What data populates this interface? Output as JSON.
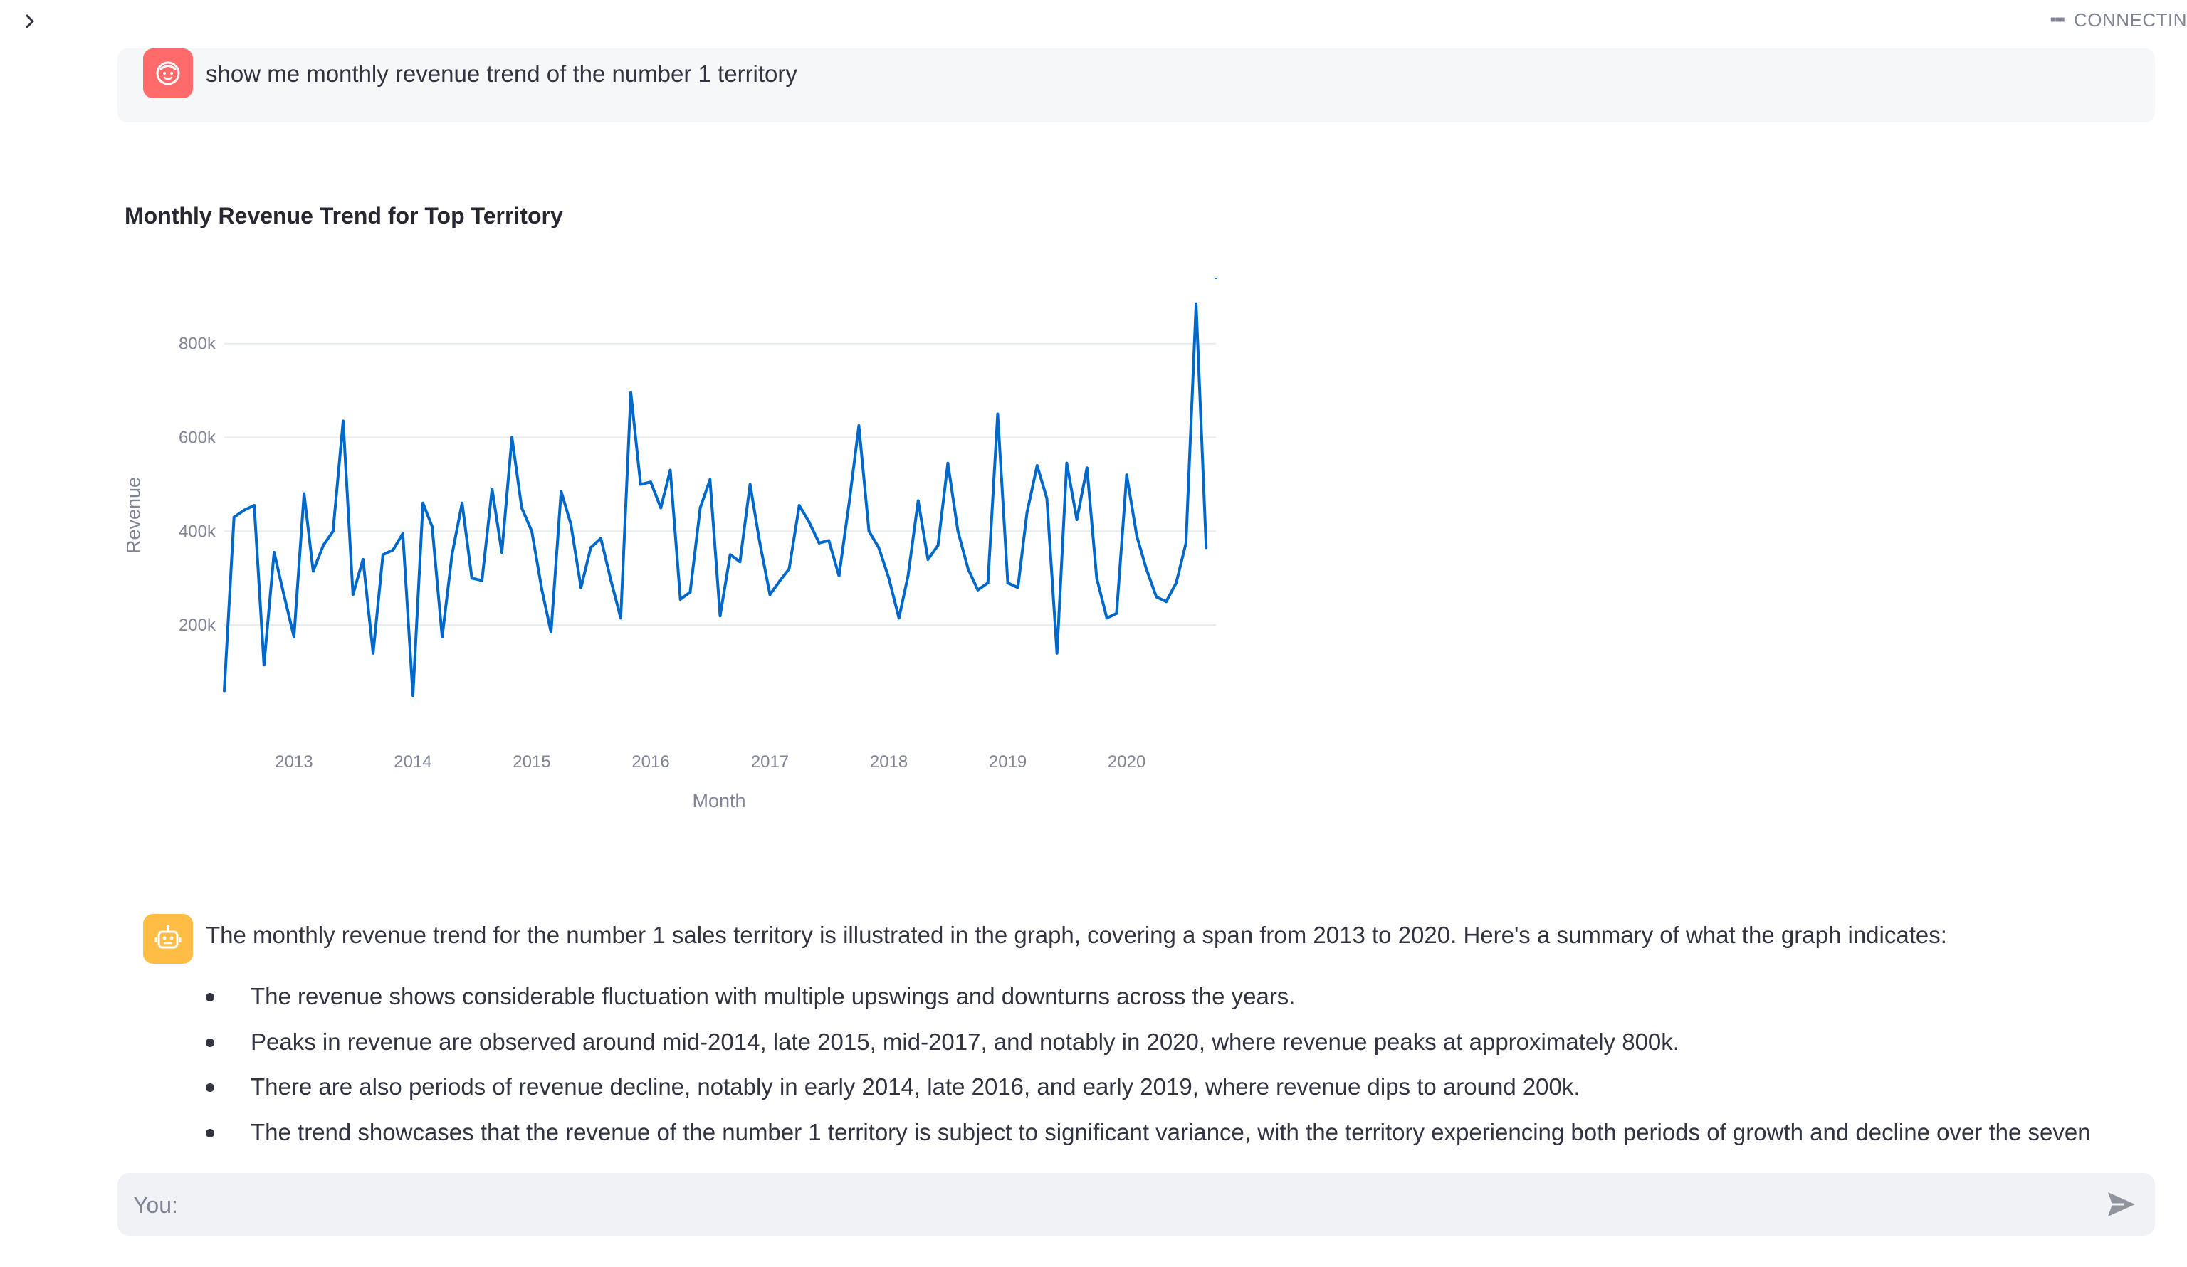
{
  "status": {
    "text": "CONNECTIN",
    "icon": "dots-icon"
  },
  "sidebar": {
    "toggle_icon": "chevron-right-icon"
  },
  "user_message": {
    "avatar_icon": "face-icon",
    "avatar_color": "#ff6b6b",
    "text": "show me monthly revenue trend of the number 1 territory"
  },
  "chart": {
    "title": "Monthly Revenue Trend for Top Territory",
    "xlabel": "Month",
    "ylabel": "Revenue"
  },
  "chart_data": {
    "type": "line",
    "title": "Monthly Revenue Trend for Top Territory",
    "xlabel": "Month",
    "ylabel": "Revenue",
    "line_color": "#0068c9",
    "grid": true,
    "ylim": [
      0,
      880000
    ],
    "yticks": [
      200000,
      400000,
      600000,
      800000
    ],
    "ytick_labels": [
      "200k",
      "400k",
      "600k",
      "800k"
    ],
    "xticks": [
      "2013-01-01",
      "2014-01-01",
      "2015-01-01",
      "2016-01-01",
      "2017-01-01",
      "2018-01-01",
      "2019-01-01",
      "2020-01-01"
    ],
    "xtick_labels": [
      "2013",
      "2014",
      "2015",
      "2016",
      "2017",
      "2018",
      "2019",
      "2020"
    ],
    "x": [
      "2012-06-01",
      "2012-07-01",
      "2012-08-01",
      "2012-09-01",
      "2012-10-01",
      "2012-11-01",
      "2012-12-01",
      "2013-01-01",
      "2013-02-01",
      "2013-03-01",
      "2013-04-01",
      "2013-05-01",
      "2013-06-01",
      "2013-07-01",
      "2013-08-01",
      "2013-09-01",
      "2013-10-01",
      "2013-11-01",
      "2013-12-01",
      "2014-01-01",
      "2014-02-01",
      "2014-03-01",
      "2014-04-01",
      "2014-05-01",
      "2014-06-01",
      "2014-07-01",
      "2014-08-01",
      "2014-09-01",
      "2014-10-01",
      "2014-11-01",
      "2014-12-01",
      "2015-01-01",
      "2015-02-01",
      "2015-03-01",
      "2015-04-01",
      "2015-05-01",
      "2015-06-01",
      "2015-07-01",
      "2015-08-01",
      "2015-09-01",
      "2015-10-01",
      "2015-11-01",
      "2015-12-01",
      "2016-01-01",
      "2016-02-01",
      "2016-03-01",
      "2016-04-01",
      "2016-05-01",
      "2016-06-01",
      "2016-07-01",
      "2016-08-01",
      "2016-09-01",
      "2016-10-01",
      "2016-11-01",
      "2016-12-01",
      "2017-01-01",
      "2017-02-01",
      "2017-03-01",
      "2017-04-01",
      "2017-05-01",
      "2017-06-01",
      "2017-07-01",
      "2017-08-01",
      "2017-09-01",
      "2017-10-01",
      "2017-11-01",
      "2017-12-01",
      "2018-01-01",
      "2018-02-01",
      "2018-03-01",
      "2018-04-01",
      "2018-05-01",
      "2018-06-01",
      "2018-07-01",
      "2018-08-01",
      "2018-09-01",
      "2018-10-01",
      "2018-11-01",
      "2018-12-01",
      "2019-01-01",
      "2019-02-01",
      "2019-03-01",
      "2019-04-01",
      "2019-05-01",
      "2019-06-01",
      "2019-07-01",
      "2019-08-01",
      "2019-09-01",
      "2019-10-01",
      "2019-11-01",
      "2019-12-01",
      "2020-01-01",
      "2020-02-01",
      "2020-03-01",
      "2020-04-01",
      "2020-05-01",
      "2020-06-01",
      "2020-07-01",
      "2020-08-01",
      "2020-09-01",
      "2020-10-01"
    ],
    "series": [
      {
        "values": [
          60000,
          430000,
          445000,
          455000,
          115000,
          355000,
          265000,
          175000,
          480000,
          315000,
          370000,
          400000,
          635000,
          265000,
          340000,
          140000,
          350000,
          360000,
          395000,
          50000,
          460000,
          410000,
          175000,
          350000,
          460000,
          300000,
          295000,
          490000,
          355000,
          600000,
          450000,
          400000,
          275000,
          185000,
          485000,
          415000,
          280000,
          365000,
          385000,
          295000,
          215000,
          695000,
          500000,
          505000,
          450000,
          530000,
          255000,
          270000,
          450000,
          510000,
          220000,
          350000,
          335000,
          500000,
          375000,
          265000,
          295000,
          320000,
          455000,
          420000,
          375000,
          380000,
          305000,
          460000,
          625000,
          400000,
          365000,
          300000,
          215000,
          305000,
          465000,
          340000,
          370000,
          545000,
          400000,
          320000,
          275000,
          290000,
          650000,
          290000,
          280000,
          440000,
          540000,
          470000,
          140000,
          545000,
          425000,
          535000,
          300000,
          215000,
          225000,
          520000,
          390000,
          320000,
          260000,
          250000,
          290000,
          375000,
          885000,
          365000
        ]
      }
    ]
  },
  "bot_message": {
    "avatar_icon": "robot-icon",
    "avatar_color": "#ffbd45",
    "intro": "The monthly revenue trend for the number 1 sales territory is illustrated in the graph, covering a span from 2013 to 2020. Here's a summary of what the graph indicates:",
    "bullets": [
      "The revenue shows considerable fluctuation with multiple upswings and downturns across the years.",
      "Peaks in revenue are observed around mid-2014, late 2015, mid-2017, and notably in 2020, where revenue peaks at approximately 800k.",
      "There are also periods of revenue decline, notably in early 2014, late 2016, and early 2019, where revenue dips to around 200k.",
      "The trend showcases that the revenue of the number 1 territory is subject to significant variance, with the territory experiencing both periods of growth and decline over the seven"
    ]
  },
  "chat_input": {
    "placeholder": "You:",
    "value": "",
    "send_icon": "send-icon"
  }
}
